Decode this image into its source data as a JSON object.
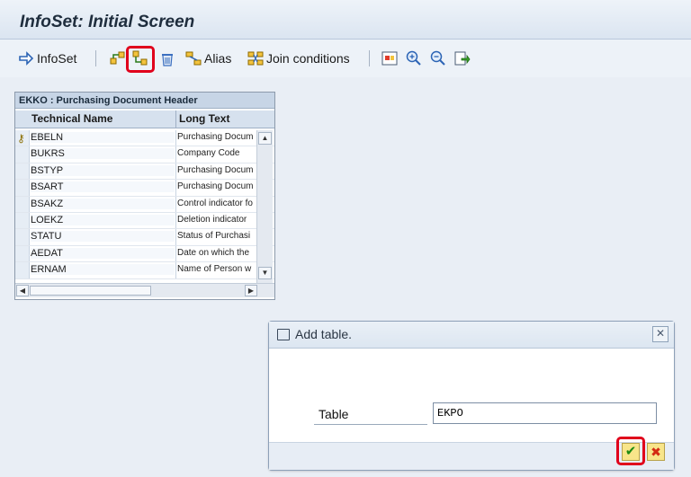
{
  "window": {
    "title": "InfoSet: Initial Screen"
  },
  "toolbar": {
    "infoset_label": "InfoSet",
    "alias_label": "Alias",
    "join_label": "Join conditions",
    "accent": "#e0001b"
  },
  "table_panel": {
    "title": "EKKO : Purchasing Document Header",
    "columns": [
      "Technical Name",
      "Long Text"
    ],
    "rows": [
      {
        "name": "EBELN",
        "text": "Purchasing Docum"
      },
      {
        "name": "BUKRS",
        "text": "Company Code"
      },
      {
        "name": "BSTYP",
        "text": "Purchasing Docum"
      },
      {
        "name": "BSART",
        "text": "Purchasing Docum"
      },
      {
        "name": "BSAKZ",
        "text": "Control indicator fo"
      },
      {
        "name": "LOEKZ",
        "text": "Deletion indicator"
      },
      {
        "name": "STATU",
        "text": "Status of Purchasi"
      },
      {
        "name": "AEDAT",
        "text": "Date on which the"
      },
      {
        "name": "ERNAM",
        "text": "Name of Person w"
      }
    ]
  },
  "dialog": {
    "title": "Add table.",
    "field_label": "Table",
    "field_value": "EKPO",
    "ok_icon": "check-icon",
    "cancel_icon": "cancel-icon"
  }
}
